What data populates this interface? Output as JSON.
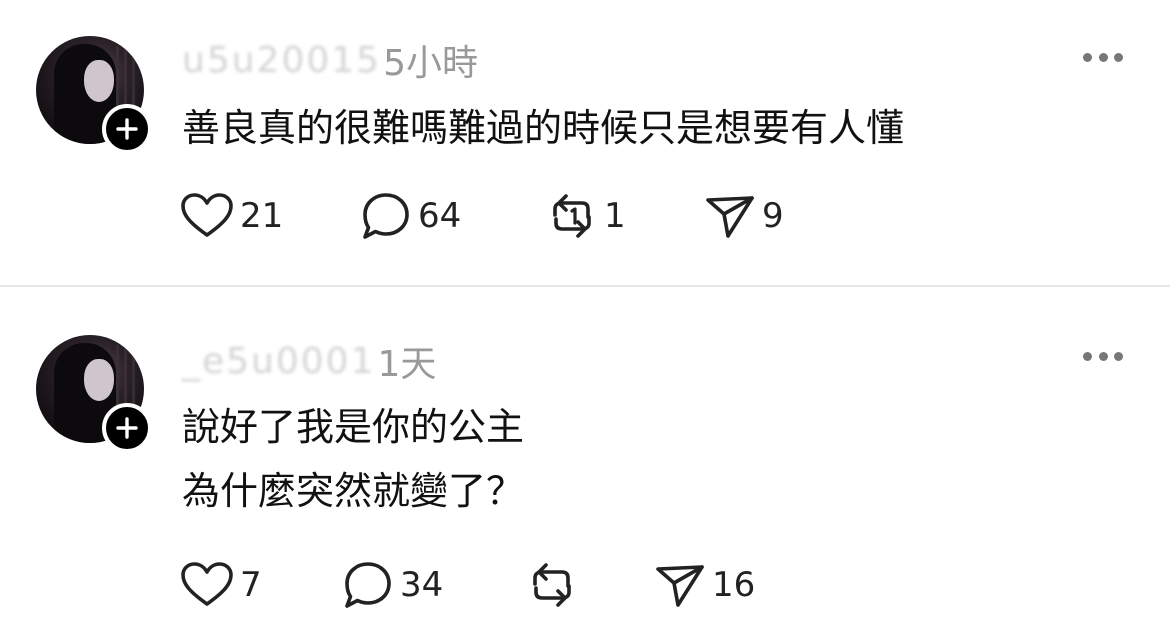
{
  "posts": [
    {
      "username": "u5u20015",
      "time": "5小時",
      "text_lines": [
        "善良真的很難嗎難過的時候只是想要有人懂"
      ],
      "likes": "21",
      "comments": "64",
      "reposts": "1",
      "shares": "9"
    },
    {
      "username": "_e5u0001",
      "time": "1天",
      "text_lines": [
        "說好了我是你的公主",
        "為什麼突然就變了？"
      ],
      "likes": "7",
      "comments": "34",
      "reposts": "",
      "shares": "16"
    }
  ],
  "icons": {
    "like": "heart-icon",
    "comment": "comment-bubble-icon",
    "repost": "repost-icon",
    "share": "send-icon",
    "more": "more-dots-icon",
    "follow": "plus-icon"
  },
  "colors": {
    "text": "#111111",
    "muted": "#999999",
    "icon": "#222222",
    "divider": "#e6e6e6"
  }
}
